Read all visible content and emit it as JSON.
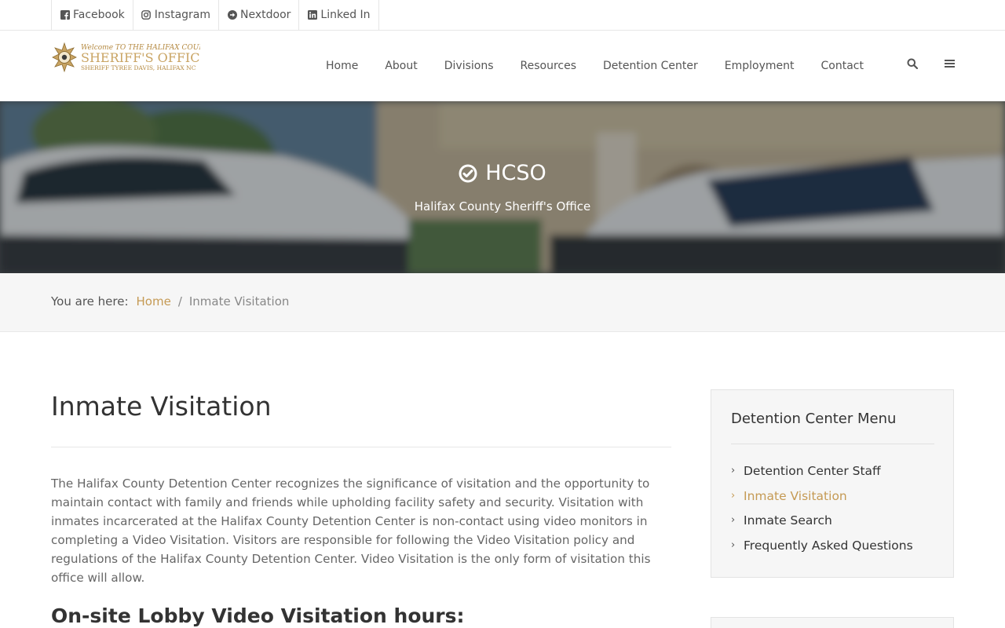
{
  "social": [
    {
      "label": "Facebook",
      "icon": "facebook-square-icon"
    },
    {
      "label": "Instagram",
      "icon": "instagram-icon"
    },
    {
      "label": "Nextdoor",
      "icon": "arrow-circle-right-icon"
    },
    {
      "label": "Linked In",
      "icon": "linkedin-square-icon"
    }
  ],
  "logo": {
    "line1": "Welcome TO THE HALIFAX COUNTY",
    "line2": "SHERIFF'S OFFICE",
    "line3": "SHERIFF TYREE DAVIS, HALIFAX NC"
  },
  "nav": [
    "Home",
    "About",
    "Divisions",
    "Resources",
    "Detention Center",
    "Employment",
    "Contact"
  ],
  "nav_icons": [
    "search-icon",
    "menu-icon"
  ],
  "hero": {
    "title": "HCSO",
    "subtitle": "Halifax County Sheriff's Office",
    "icon": "check-circle-icon"
  },
  "breadcrumb": {
    "prefix": "You are here:",
    "home": "Home",
    "separator": "/",
    "current": "Inmate Visitation"
  },
  "main": {
    "title": "Inmate Visitation",
    "intro": "The Halifax County Detention Center recognizes the significance of visitation and the opportunity to maintain contact with family and friends while upholding facility safety and security. Visitation with inmates incarcerated at the Halifax County Detention Center is non-contact using video monitors in completing a Video Visitation. Visitors are responsible for following the Video Visitation policy and regulations of the Halifax County Detention Center. Video Visitation is the only form of visitation this office will allow.",
    "subheading": "On-site Lobby Video Visitation hours:"
  },
  "sidebar": {
    "title": "Detention Center Menu",
    "items": [
      {
        "label": "Detention Center Staff",
        "active": false
      },
      {
        "label": "Inmate Visitation",
        "active": true
      },
      {
        "label": "Inmate Search",
        "active": false
      },
      {
        "label": "Frequently Asked Questions",
        "active": false
      }
    ]
  },
  "colors": {
    "accent": "#c59a54",
    "text": "#333333",
    "muted": "#666666",
    "panel": "#f6f6f6"
  }
}
